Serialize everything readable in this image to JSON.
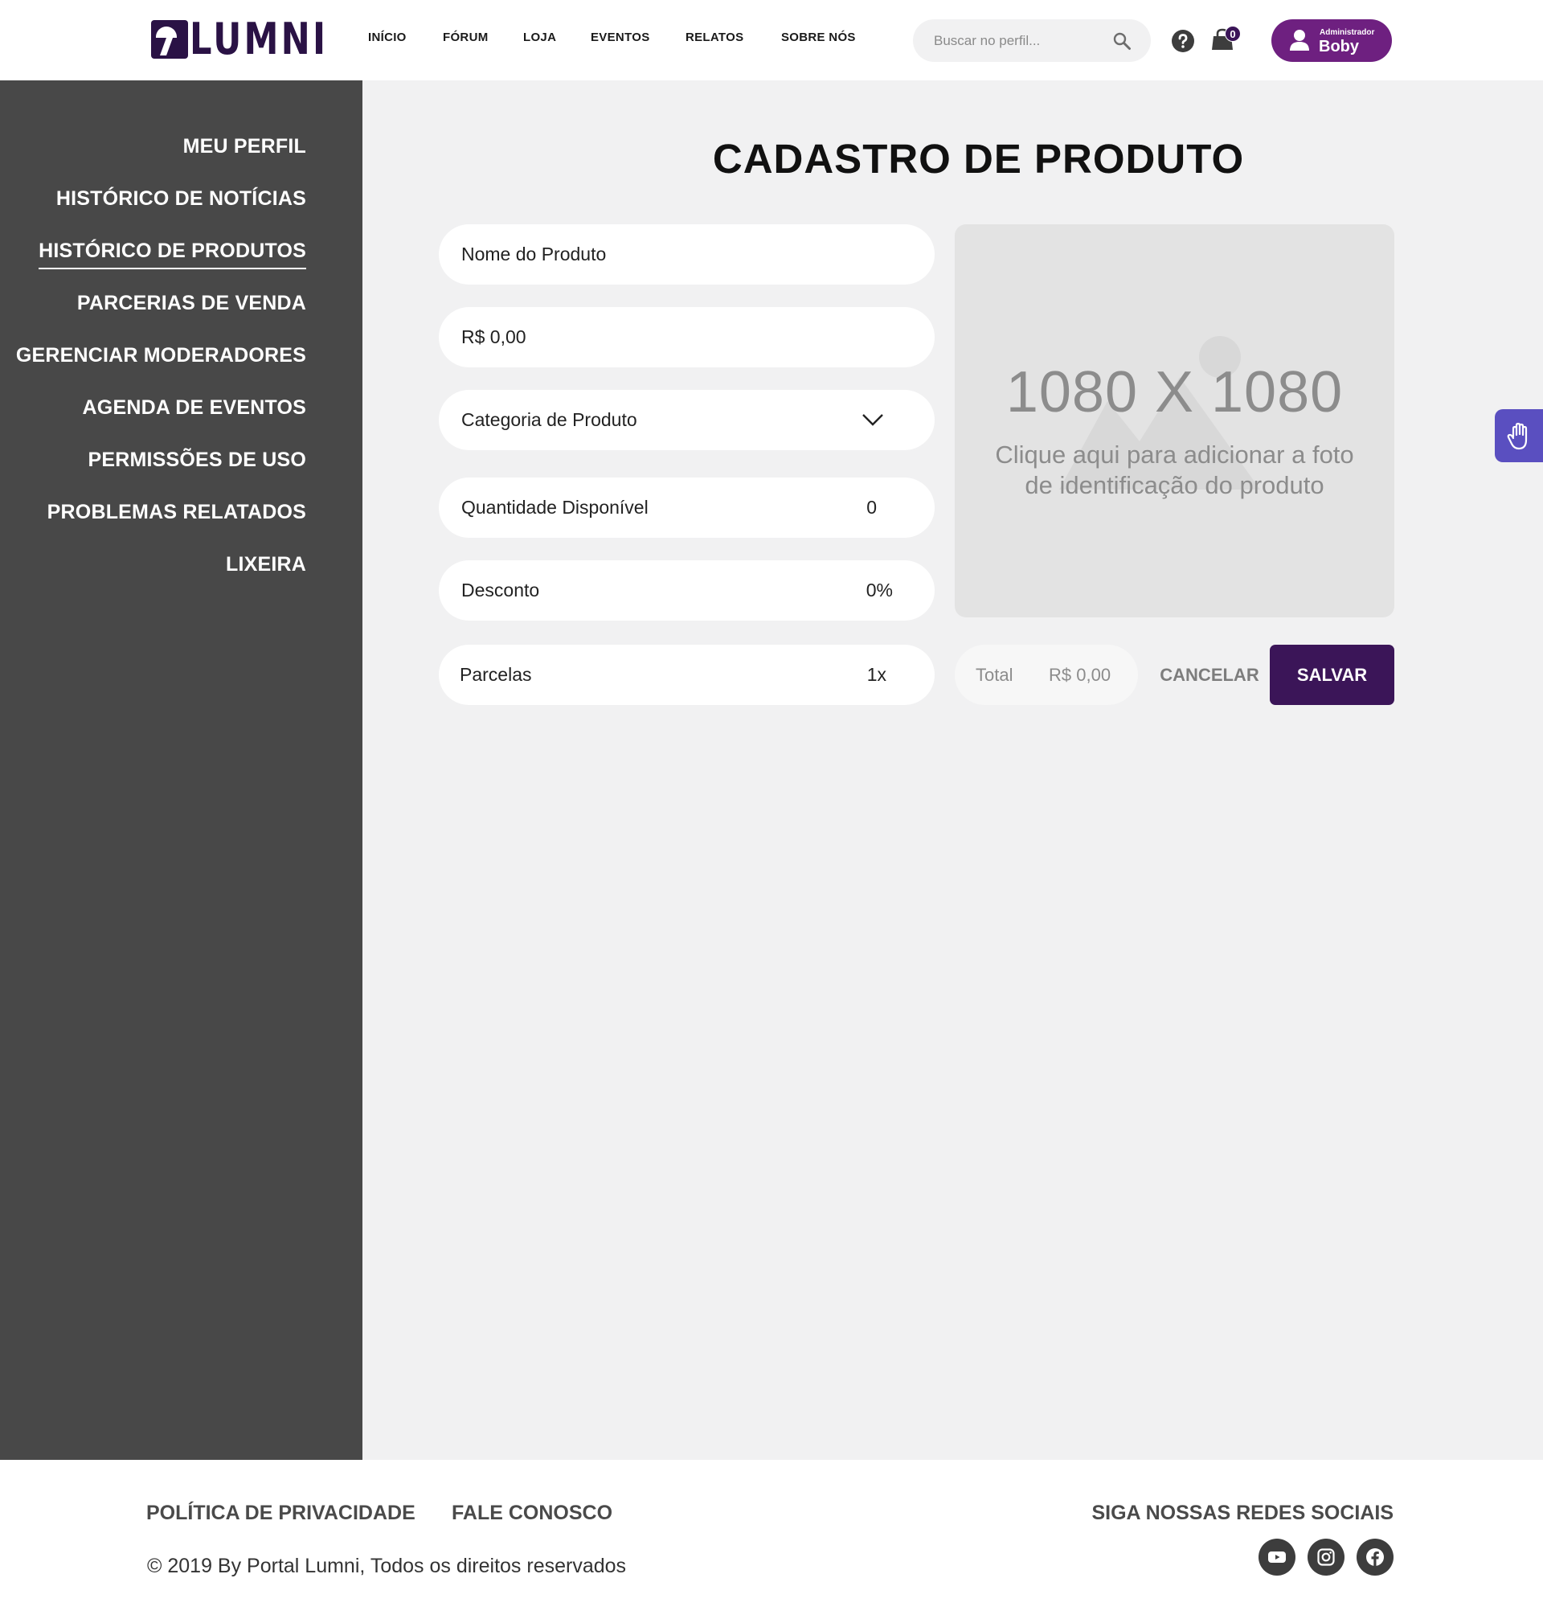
{
  "header": {
    "logo_text": "LUMNI",
    "nav": [
      "INÍCIO",
      "FÓRUM",
      "LOJA",
      "EVENTOS",
      "RELATOS",
      "SOBRE NÓS"
    ],
    "search_placeholder": "Buscar no perfil...",
    "cart_count": "0",
    "user": {
      "role": "Administrador",
      "name": "Boby"
    }
  },
  "sidebar": {
    "items": [
      "MEU PERFIL",
      "HISTÓRICO DE NOTÍCIAS",
      "HISTÓRICO DE PRODUTOS",
      "PARCERIAS DE VENDA",
      "GERENCIAR MODERADORES",
      "AGENDA DE EVENTOS",
      "PERMISSÕES DE USO",
      "PROBLEMAS RELATADOS",
      "LIXEIRA"
    ],
    "active_item": "HISTÓRICO DE PRODUTOS"
  },
  "form": {
    "title": "CADASTRO DE PRODUTO",
    "product_name_placeholder": "Nome do Produto",
    "price_placeholder": "R$ 0,00",
    "category_label": "Categoria de Produto",
    "quantity": {
      "label": "Quantidade Disponível",
      "value": "0"
    },
    "discount": {
      "label": "Desconto",
      "value": "0%"
    },
    "installments": {
      "label": "Parcelas",
      "value": "1x"
    },
    "image": {
      "dimensions": "1080 X 1080",
      "hint": "Clique aqui para adicionar a foto de identificação do produto"
    },
    "total": {
      "label": "Total",
      "value": "R$ 0,00"
    },
    "cancel_label": "CANCELAR",
    "save_label": "SALVAR"
  },
  "footer": {
    "privacy": "POLÍTICA DE PRIVACIDADE",
    "contact": "FALE CONOSCO",
    "copyright": "© 2019 By Portal Lumni, Todos os direitos reservados",
    "social_title": "SIGA NOSSAS REDES SOCIAIS",
    "social_icons": [
      "youtube-icon",
      "instagram-icon",
      "facebook-icon"
    ]
  },
  "colors": {
    "brand_dark": "#3b1558",
    "user_button": "#6e2080",
    "sidebar_bg": "#484848",
    "content_bg": "#f1f1f2",
    "accessibility": "#5a4fc0"
  }
}
